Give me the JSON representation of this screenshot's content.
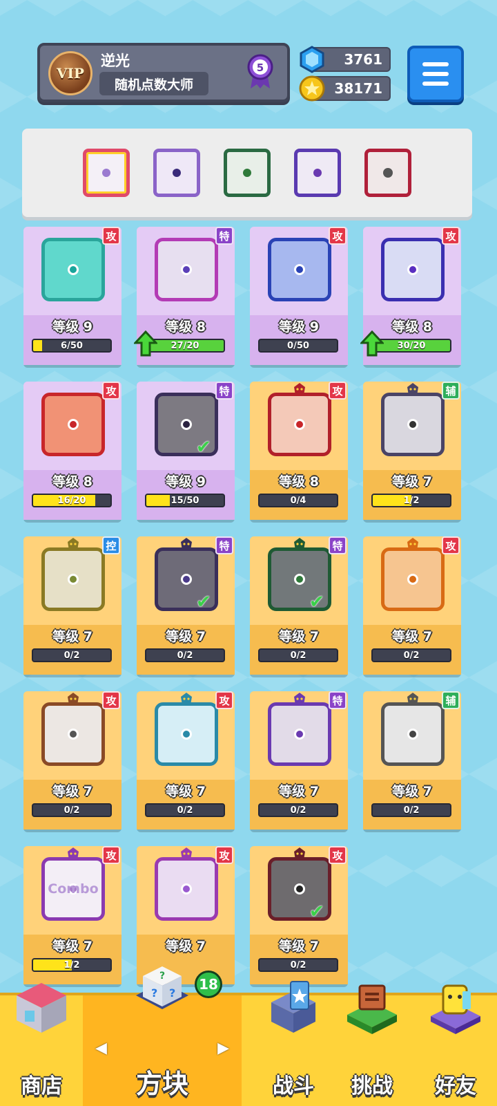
{
  "profile": {
    "vip_label": "VIP",
    "username": "逆光",
    "title": "随机点数大师",
    "rank": "5"
  },
  "currency": {
    "gems": "3761",
    "coins": "38171"
  },
  "colors": {
    "attack_tag": "#e33648",
    "special_tag": "#8a43c8",
    "support_tag": "#2eae5a",
    "control_tag": "#2a8ce6",
    "epic_card": "#d9b8f0",
    "legend_card": "#f5c15e"
  },
  "deck": [
    {
      "icon": "rainbow-die-icon"
    },
    {
      "icon": "purple-crack-die-icon"
    },
    {
      "icon": "green-dragon-die-icon"
    },
    {
      "icon": "purple-dragon-die-icon"
    },
    {
      "icon": "red-dragon-saw-die-icon"
    }
  ],
  "cards": [
    {
      "tag": "攻",
      "tag_type": "atk",
      "rarity": "epic",
      "die": "#60d8cc",
      "frame": "#2aa59b",
      "pip": "#1aa59b",
      "level": "等级 9",
      "progress": "6/50",
      "fill": 0.12,
      "upgrade": false,
      "equipped": false,
      "dragon": false
    },
    {
      "tag": "特",
      "tag_type": "spc",
      "rarity": "epic",
      "die": "#e7dff0",
      "frame": "#b33bb5",
      "pip": "#5b3fb8",
      "level": "等级 8",
      "progress": "27/20",
      "fill": 1,
      "upgrade": true,
      "equipped": false,
      "dragon": false
    },
    {
      "tag": "攻",
      "tag_type": "atk",
      "rarity": "epic",
      "die": "#a7b8ef",
      "frame": "#2a43b5",
      "pip": "#2a43b5",
      "level": "等级 9",
      "progress": "0/50",
      "fill": 0,
      "upgrade": false,
      "equipped": false,
      "dragon": false
    },
    {
      "tag": "攻",
      "tag_type": "atk",
      "rarity": "epic",
      "die": "#d9dcf4",
      "frame": "#3a2fb0",
      "pip": "#5a2fc0",
      "level": "等级 8",
      "progress": "30/20",
      "fill": 1,
      "upgrade": true,
      "equipped": false,
      "dragon": false
    },
    {
      "tag": "攻",
      "tag_type": "atk",
      "rarity": "epic",
      "die": "#f19275",
      "frame": "#c8262a",
      "pip": "#c8262a",
      "level": "等级 8",
      "progress": "16/20",
      "fill": 0.8,
      "upgrade": false,
      "equipped": false,
      "dragon": false
    },
    {
      "tag": "特",
      "tag_type": "spc",
      "rarity": "epic",
      "die": "#7d7a82",
      "frame": "#3a2f5a",
      "pip": "#2a2240",
      "level": "等级 9",
      "progress": "15/50",
      "fill": 0.3,
      "upgrade": false,
      "equipped": true,
      "dragon": false
    },
    {
      "tag": "攻",
      "tag_type": "atk",
      "rarity": "legend",
      "die": "#f4c9b8",
      "frame": "#b1202a",
      "pip": "#c8262a",
      "level": "等级 8",
      "progress": "0/4",
      "fill": 0,
      "upgrade": false,
      "equipped": false,
      "dragon": true
    },
    {
      "tag": "辅",
      "tag_type": "sup",
      "rarity": "legend",
      "die": "#d9d7df",
      "frame": "#4a4466",
      "pip": "#333",
      "level": "等级 7",
      "progress": "1/2",
      "fill": 0.5,
      "upgrade": false,
      "equipped": false,
      "dragon": true
    },
    {
      "tag": "控",
      "tag_type": "ctl",
      "rarity": "legend",
      "die": "#e6e0c7",
      "frame": "#8a7a24",
      "pip": "#7a8a34",
      "level": "等级 7",
      "progress": "0/2",
      "fill": 0,
      "upgrade": false,
      "equipped": false,
      "dragon": true
    },
    {
      "tag": "特",
      "tag_type": "spc",
      "rarity": "legend",
      "die": "#6e6b78",
      "frame": "#3a2f5a",
      "pip": "#4a3a8a",
      "level": "等级 7",
      "progress": "0/2",
      "fill": 0,
      "upgrade": false,
      "equipped": true,
      "dragon": true
    },
    {
      "tag": "特",
      "tag_type": "spc",
      "rarity": "legend",
      "die": "#72787a",
      "frame": "#1f5a34",
      "pip": "#2f7a3a",
      "level": "等级 7",
      "progress": "0/2",
      "fill": 0,
      "upgrade": false,
      "equipped": true,
      "dragon": true
    },
    {
      "tag": "攻",
      "tag_type": "atk",
      "rarity": "legend",
      "die": "#f6c590",
      "frame": "#d86a14",
      "pip": "#d86a14",
      "level": "等级 7",
      "progress": "0/2",
      "fill": 0,
      "upgrade": false,
      "equipped": false,
      "dragon": true
    },
    {
      "tag": "攻",
      "tag_type": "atk",
      "rarity": "legend",
      "die": "#ece7e3",
      "frame": "#8a4a26",
      "pip": "#555",
      "level": "等级 7",
      "progress": "0/2",
      "fill": 0,
      "upgrade": false,
      "equipped": false,
      "dragon": true
    },
    {
      "tag": "攻",
      "tag_type": "atk",
      "rarity": "legend",
      "die": "#d6eef6",
      "frame": "#2a8aa8",
      "pip": "#2a8aa8",
      "level": "等级 7",
      "progress": "0/2",
      "fill": 0,
      "upgrade": false,
      "equipped": false,
      "dragon": true
    },
    {
      "tag": "特",
      "tag_type": "spc",
      "rarity": "legend",
      "die": "#e2dbe8",
      "frame": "#6a3ab0",
      "pip": "#6a3ab0",
      "level": "等级 7",
      "progress": "0/2",
      "fill": 0,
      "upgrade": false,
      "equipped": false,
      "dragon": true
    },
    {
      "tag": "辅",
      "tag_type": "sup",
      "rarity": "legend",
      "die": "#e6e6e6",
      "frame": "#555",
      "pip": "#444",
      "level": "等级 7",
      "progress": "0/2",
      "fill": 0,
      "upgrade": false,
      "equipped": false,
      "dragon": true
    },
    {
      "tag": "攻",
      "tag_type": "atk",
      "rarity": "legend",
      "die": "#f3eef6",
      "frame": "#8a3ab0",
      "pip": "#a678c8",
      "level": "等级 7",
      "progress": "1/2",
      "fill": 0.5,
      "upgrade": false,
      "equipped": false,
      "dragon": true,
      "text": "Combo"
    },
    {
      "tag": "攻",
      "tag_type": "atk",
      "rarity": "legend",
      "die": "#eadcf2",
      "frame": "#9a3ab0",
      "pip": "#9a5ad0",
      "level": "等级 7",
      "progress": "",
      "fill": 0,
      "upgrade": false,
      "equipped": false,
      "dragon": true
    },
    {
      "tag": "攻",
      "tag_type": "atk",
      "rarity": "legend",
      "die": "#6e6b6e",
      "frame": "#6a1f2a",
      "pip": "#222",
      "level": "等级 7",
      "progress": "0/2",
      "fill": 0,
      "upgrade": false,
      "equipped": true,
      "dragon": true
    }
  ],
  "nav": {
    "shop": "商店",
    "dice": "方块",
    "dice_badge": "18",
    "battle": "战斗",
    "challenge": "挑战",
    "friends": "好友"
  }
}
